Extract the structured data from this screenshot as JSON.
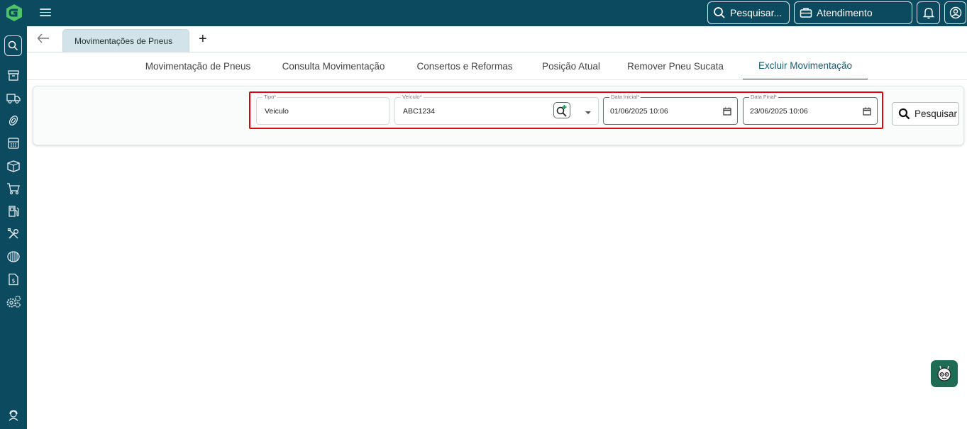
{
  "topbar": {
    "search_label": "Pesquisar...",
    "atendimento_label": "Atendimento"
  },
  "tabstrip": {
    "active_doc_tab": "Movimentações de Pneus",
    "add_tab": "+"
  },
  "nav_tabs": [
    {
      "label": "Movimentação de Pneus"
    },
    {
      "label": "Consulta Movimentação"
    },
    {
      "label": "Consertos e Reformas"
    },
    {
      "label": "Posição Atual"
    },
    {
      "label": "Remover Pneu Sucata"
    },
    {
      "label": "Excluir Movimentação",
      "active": true
    }
  ],
  "form": {
    "tipo": {
      "label": "Tipo*",
      "value": "Veiculo"
    },
    "veiculo": {
      "label": "Veículo*",
      "value": "ABC1234"
    },
    "data_inicial": {
      "label": "Data Inicial*",
      "value": "01/06/2025 10:06"
    },
    "data_final": {
      "label": "Data Final*",
      "value": "23/06/2025 10:06"
    },
    "search_button": "Pesquisar"
  },
  "colors": {
    "primary": "#0b4a5f",
    "highlight": "#e1000f",
    "assistant": "#1f6b53"
  },
  "sidebar_icons": [
    "search-icon",
    "archive-icon",
    "truck-icon",
    "tire-icon",
    "calculator-icon",
    "box-icon",
    "cart-icon",
    "fuel-icon",
    "tools-icon",
    "tire-tread-icon",
    "invoice-icon",
    "settings-gears-icon",
    "support-icon"
  ]
}
